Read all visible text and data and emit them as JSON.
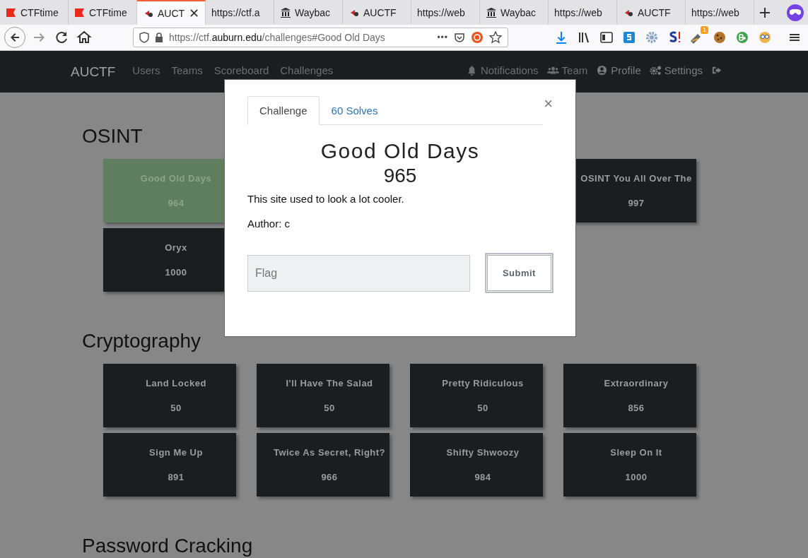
{
  "browser": {
    "tabs": [
      {
        "title": "CTFtime",
        "kind": "ctftime",
        "selected": false
      },
      {
        "title": "CTFtime",
        "kind": "ctftime",
        "selected": false
      },
      {
        "title": "AUCT",
        "kind": "auctf",
        "selected": true
      },
      {
        "title": "https://ctf.a",
        "kind": "plain",
        "selected": false
      },
      {
        "title": "Waybac",
        "kind": "wayback",
        "selected": false
      },
      {
        "title": "AUCTF",
        "kind": "auctf",
        "selected": false
      },
      {
        "title": "https://web",
        "kind": "plain",
        "selected": false
      },
      {
        "title": "Waybac",
        "kind": "wayback",
        "selected": false
      },
      {
        "title": "https://web",
        "kind": "plain",
        "selected": false
      },
      {
        "title": "AUCTF",
        "kind": "auctf",
        "selected": false
      },
      {
        "title": "https://web",
        "kind": "plain",
        "selected": false
      }
    ],
    "tab_close": "✕",
    "url": {
      "scheme": "https://ctf.",
      "host": "auburn.edu",
      "path": "/challenges#Good Old Days"
    },
    "url_more": "•••",
    "extension_badge": "1"
  },
  "navbar": {
    "brand": "AUCTF",
    "links": [
      "Users",
      "Teams",
      "Scoreboard",
      "Challenges"
    ],
    "right": [
      {
        "label": "Notifications",
        "kind": "bell"
      },
      {
        "label": "Team",
        "kind": "users"
      },
      {
        "label": "Profile",
        "kind": "user"
      },
      {
        "label": "Settings",
        "kind": "gears"
      },
      {
        "kind": "logout"
      }
    ]
  },
  "categories": [
    {
      "name": "OSINT",
      "challenges": [
        {
          "name": "Good Old Days",
          "points": "964",
          "solved": true
        },
        {
          "name": "OSINT You All Over The",
          "points": "997",
          "solved": false
        },
        {
          "name": "Oryx",
          "points": "1000",
          "solved": false
        }
      ]
    },
    {
      "name": "Cryptography",
      "challenges": [
        {
          "name": "Land Locked",
          "points": "50",
          "solved": false
        },
        {
          "name": "I'll Have The Salad",
          "points": "50",
          "solved": false
        },
        {
          "name": "Pretty Ridiculous",
          "points": "50",
          "solved": false
        },
        {
          "name": "Extraordinary",
          "points": "856",
          "solved": false
        },
        {
          "name": "Sign Me Up",
          "points": "891",
          "solved": false
        },
        {
          "name": "Twice As Secret, Right?",
          "points": "966",
          "solved": false
        },
        {
          "name": "Shifty Shwoozy",
          "points": "984",
          "solved": false
        },
        {
          "name": "Sleep On It",
          "points": "1000",
          "solved": false
        }
      ]
    },
    {
      "name": "Password Cracking"
    }
  ],
  "modal": {
    "tabs": [
      {
        "label": "Challenge",
        "selected": true
      },
      {
        "label": "60 Solves",
        "selected": false
      }
    ],
    "close": "×",
    "title": "Good Old Days",
    "points": "965",
    "description": "This site used to look a lot cooler.",
    "author": "Author: c",
    "flag_placeholder": "Flag",
    "submit": "Submit"
  }
}
